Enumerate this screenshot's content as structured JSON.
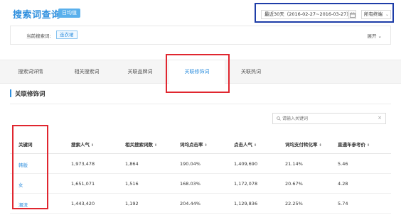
{
  "header": {
    "title": "搜索词查询",
    "badge": "日均值",
    "date_range": "最近30天（2016-02-27~2016-03-27）",
    "terminal_select": "所有终端"
  },
  "query": {
    "label": "当前搜索词:",
    "tag": "连衣裙",
    "expand_label": "展开"
  },
  "tabs": [
    {
      "label": "搜索词详情",
      "active": false
    },
    {
      "label": "相关搜索词",
      "active": false
    },
    {
      "label": "关联品牌词",
      "active": false
    },
    {
      "label": "关联修饰词",
      "active": true
    },
    {
      "label": "关联热词",
      "active": false
    }
  ],
  "section": {
    "title": "关联修饰词"
  },
  "search": {
    "placeholder": "请输入关键词",
    "clear": "×"
  },
  "table": {
    "columns": [
      "关键词",
      "搜索人气",
      "相关搜索词数",
      "词均点击率",
      "点击人气",
      "词均支付转化率",
      "直通车参考价"
    ],
    "sort_glyph": "⇕",
    "rows": [
      [
        "韩版",
        "1,973,478",
        "1,864",
        "190.04%",
        "1,409,690",
        "21.14%",
        "5.46"
      ],
      [
        "女",
        "1,651,071",
        "1,516",
        "168.03%",
        "1,172,078",
        "20.67%",
        "4.28"
      ],
      [
        "潮流",
        "1,443,420",
        "1,192",
        "204.44%",
        "1,129,836",
        "22.25%",
        "5.74"
      ]
    ]
  },
  "colors": {
    "accent": "#2f8fde",
    "highlight_red": "#e0262f",
    "highlight_blue": "#1e3da8"
  }
}
